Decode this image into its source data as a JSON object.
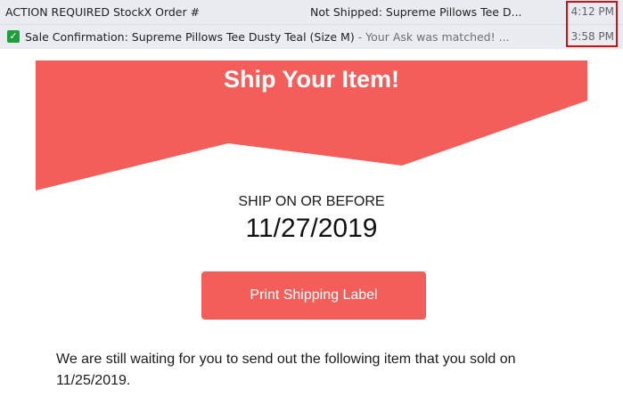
{
  "inbox": {
    "rows": [
      {
        "sender": "ACTION REQUIRED StockX Order #",
        "subject": "Not Shipped: Supreme Pillows Tee D...",
        "time": "4:12 PM"
      },
      {
        "subject": "Sale Confirmation: Supreme Pillows Tee Dusty Teal (Size M)",
        "preview": " - Your Ask was matched! ...",
        "time": "3:58 PM",
        "icon": "check-icon"
      }
    ]
  },
  "email": {
    "banner_title": "Ship Your Item!",
    "ship_label": "SHIP ON OR BEFORE",
    "ship_date": "11/27/2019",
    "print_button": "Print Shipping Label",
    "body": "We are still waiting for you to send out the following item that you sold on 11/25/2019."
  },
  "colors": {
    "banner": "#f45e5a",
    "button": "#f45e5a",
    "highlight_box": "#d80f0f",
    "row_bg": "#e9ecf0"
  }
}
